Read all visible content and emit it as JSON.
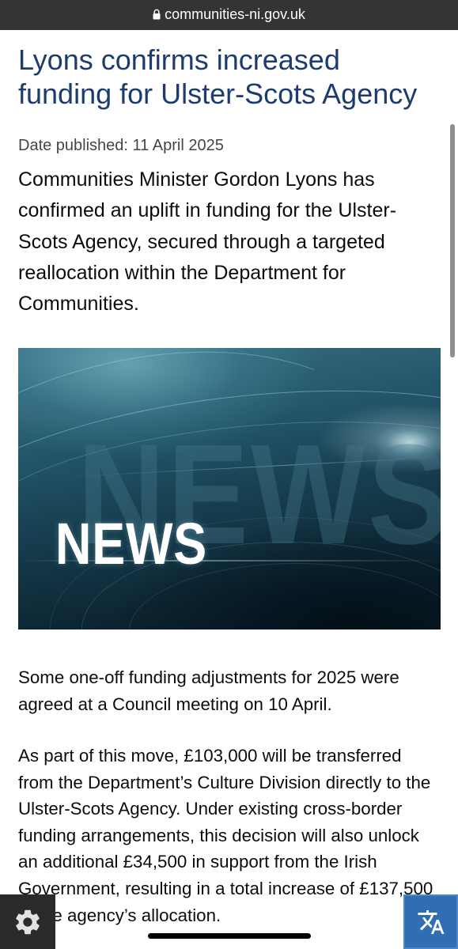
{
  "browser": {
    "url": "communities-ni.gov.uk",
    "lock_icon": "lock-icon"
  },
  "article": {
    "title": "Lyons confirms increased funding for Ulster-Scots Agency",
    "date_label": "Date published:",
    "date_value": "11 April 2025",
    "lead": "Communities Minister Gordon Lyons has confirmed an uplift in funding for the Ulster-Scots Agency, secured through a targeted reallocation within the Department for Communities.",
    "image": {
      "text": "NEWS"
    },
    "paragraphs": [
      "Some one-off funding adjustments for 2025 were agreed at a Council meeting on 10 April.",
      "As part of this move, £103,000 will be transferred from the Department’s Culture Division directly to the Ulster-Scots Agency. Under existing cross-border funding arrangements, this decision will also unlock an additional £34,500 in support from the Irish Government, resulting in a total increase of £137,500 to the agency’s allocation."
    ]
  },
  "floating_buttons": {
    "settings_icon": "gear-icon",
    "translate_icon": "translate-icon"
  },
  "colors": {
    "url_bar_background": "#333436",
    "url_text": "#ffffff",
    "title_text": "#1d3c6e",
    "date_text": "#454545",
    "body_text": "#0b0c0c",
    "settings_button_background": "#2b2b2b",
    "translate_button_background": "#2f6db5"
  }
}
